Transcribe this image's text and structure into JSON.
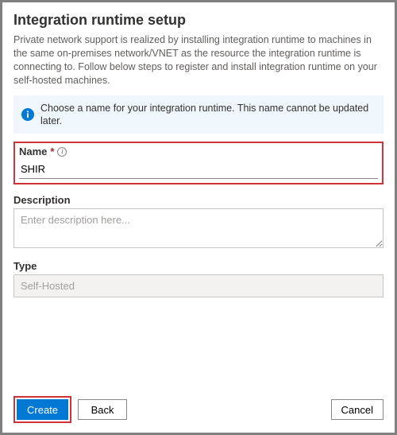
{
  "title": "Integration runtime setup",
  "intro": "Private network support is realized by installing integration runtime to machines in the same on-premises network/VNET as the resource the integration runtime is connecting to. Follow below steps to register and install integration runtime on your self-hosted machines.",
  "info_banner": "Choose a name for your integration runtime. This name cannot be updated later.",
  "fields": {
    "name": {
      "label": "Name",
      "required_marker": "*",
      "value": "SHIR"
    },
    "description": {
      "label": "Description",
      "placeholder": "Enter description here...",
      "value": ""
    },
    "type": {
      "label": "Type",
      "value": "Self-Hosted"
    }
  },
  "buttons": {
    "create": "Create",
    "back": "Back",
    "cancel": "Cancel"
  }
}
